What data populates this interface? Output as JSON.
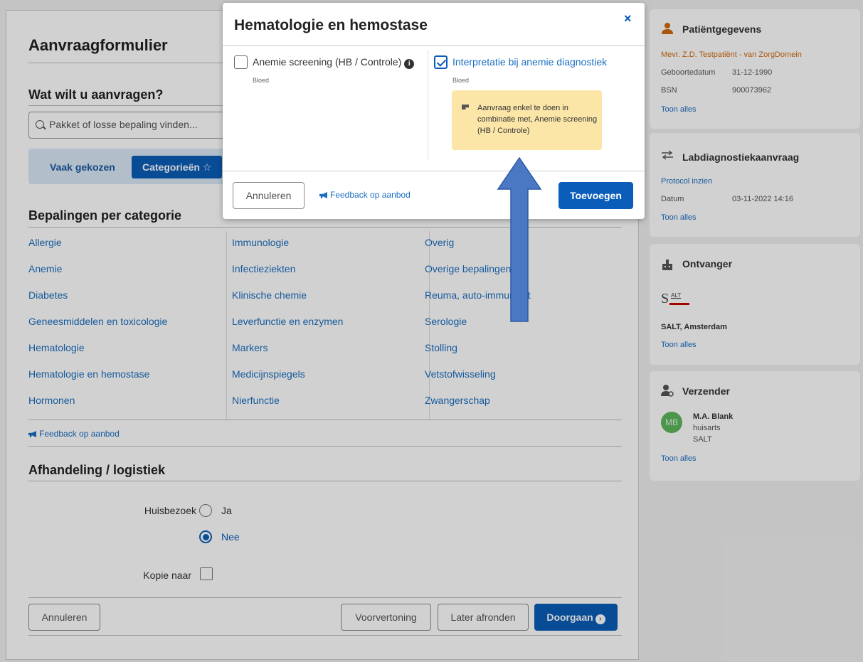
{
  "form": {
    "title": "Aanvraagformulier",
    "question": "Wat wilt u aanvragen?",
    "search_placeholder": "Pakket of losse bepaling vinden...",
    "tabs": {
      "frequent": "Vaak gekozen",
      "categories": "Categorieën ☆"
    },
    "categories_title": "Bepalingen per categorie",
    "columns": [
      [
        "Allergie",
        "Anemie",
        "Diabetes",
        "Geneesmiddelen en toxicologie",
        "Hematologie",
        "Hematologie en hemostase",
        "Hormonen"
      ],
      [
        "Immunologie",
        "Infectieziekten",
        "Klinische chemie",
        "Leverfunctie en enzymen",
        "Markers",
        "Medicijnspiegels",
        "Nierfunctie"
      ],
      [
        "Overig",
        "Overige bepalingen",
        "Reuma, auto-immuniteit",
        "Serologie",
        "Stolling",
        "Vetstofwisseling",
        "Zwangerschap"
      ]
    ],
    "feedback": "Feedback op aanbod",
    "logistics_title": "Afhandeling / logistiek",
    "home_visit_label": "Huisbezoek",
    "option_yes": "Ja",
    "option_no": "Nee",
    "home_visit_value": "Nee",
    "copy_label": "Kopie naar",
    "buttons": {
      "cancel": "Annuleren",
      "preview": "Voorvertoning",
      "later": "Later afronden",
      "continue": "Doorgaan"
    }
  },
  "side": {
    "patient": {
      "title": "Patiëntgegevens",
      "name": "Mevr. Z.D. Testpatiënt - van ZorgDomein",
      "dob_label": "Geboortedatum",
      "dob": "31-12-1990",
      "bsn_label": "BSN",
      "bsn": "900073962",
      "show_all": "Toon alles"
    },
    "lab": {
      "title": "Labdiagnostiekaanvraag",
      "protocol": "Protocol inzien",
      "date_label": "Datum",
      "date": "03-11-2022 14:16",
      "show_all": "Toon alles"
    },
    "receiver": {
      "title": "Ontvanger",
      "logo_text": "S",
      "logo_sup": "ALT",
      "name": "SALT, Amsterdam",
      "show_all": "Toon alles"
    },
    "sender": {
      "title": "Verzender",
      "initials": "MB",
      "name": "M.A. Blank",
      "role": "huisarts",
      "org": "SALT",
      "show_all": "Toon alles"
    }
  },
  "modal": {
    "title": "Hematologie en hemostase",
    "close": "×",
    "items": [
      {
        "label": "Anemie screening (HB / Controle)",
        "sub": "Bloed",
        "checked": false
      },
      {
        "label": "Interpretatie bij anemie diagnostiek",
        "sub": "Bloed",
        "checked": true
      }
    ],
    "info": "i",
    "note": "Aanvraag enkel te doen in combinatie met, Anemie screening (HB / Controle)",
    "cancel": "Annuleren",
    "feedback": "Feedback op aanbod",
    "add": "Toevoegen"
  },
  "colors": {
    "primary": "#0a5db8",
    "link": "#1a6ec0",
    "patient_name": "#d06a10",
    "note_bg": "#fbe6a8",
    "arrow": "#4a78c2"
  }
}
